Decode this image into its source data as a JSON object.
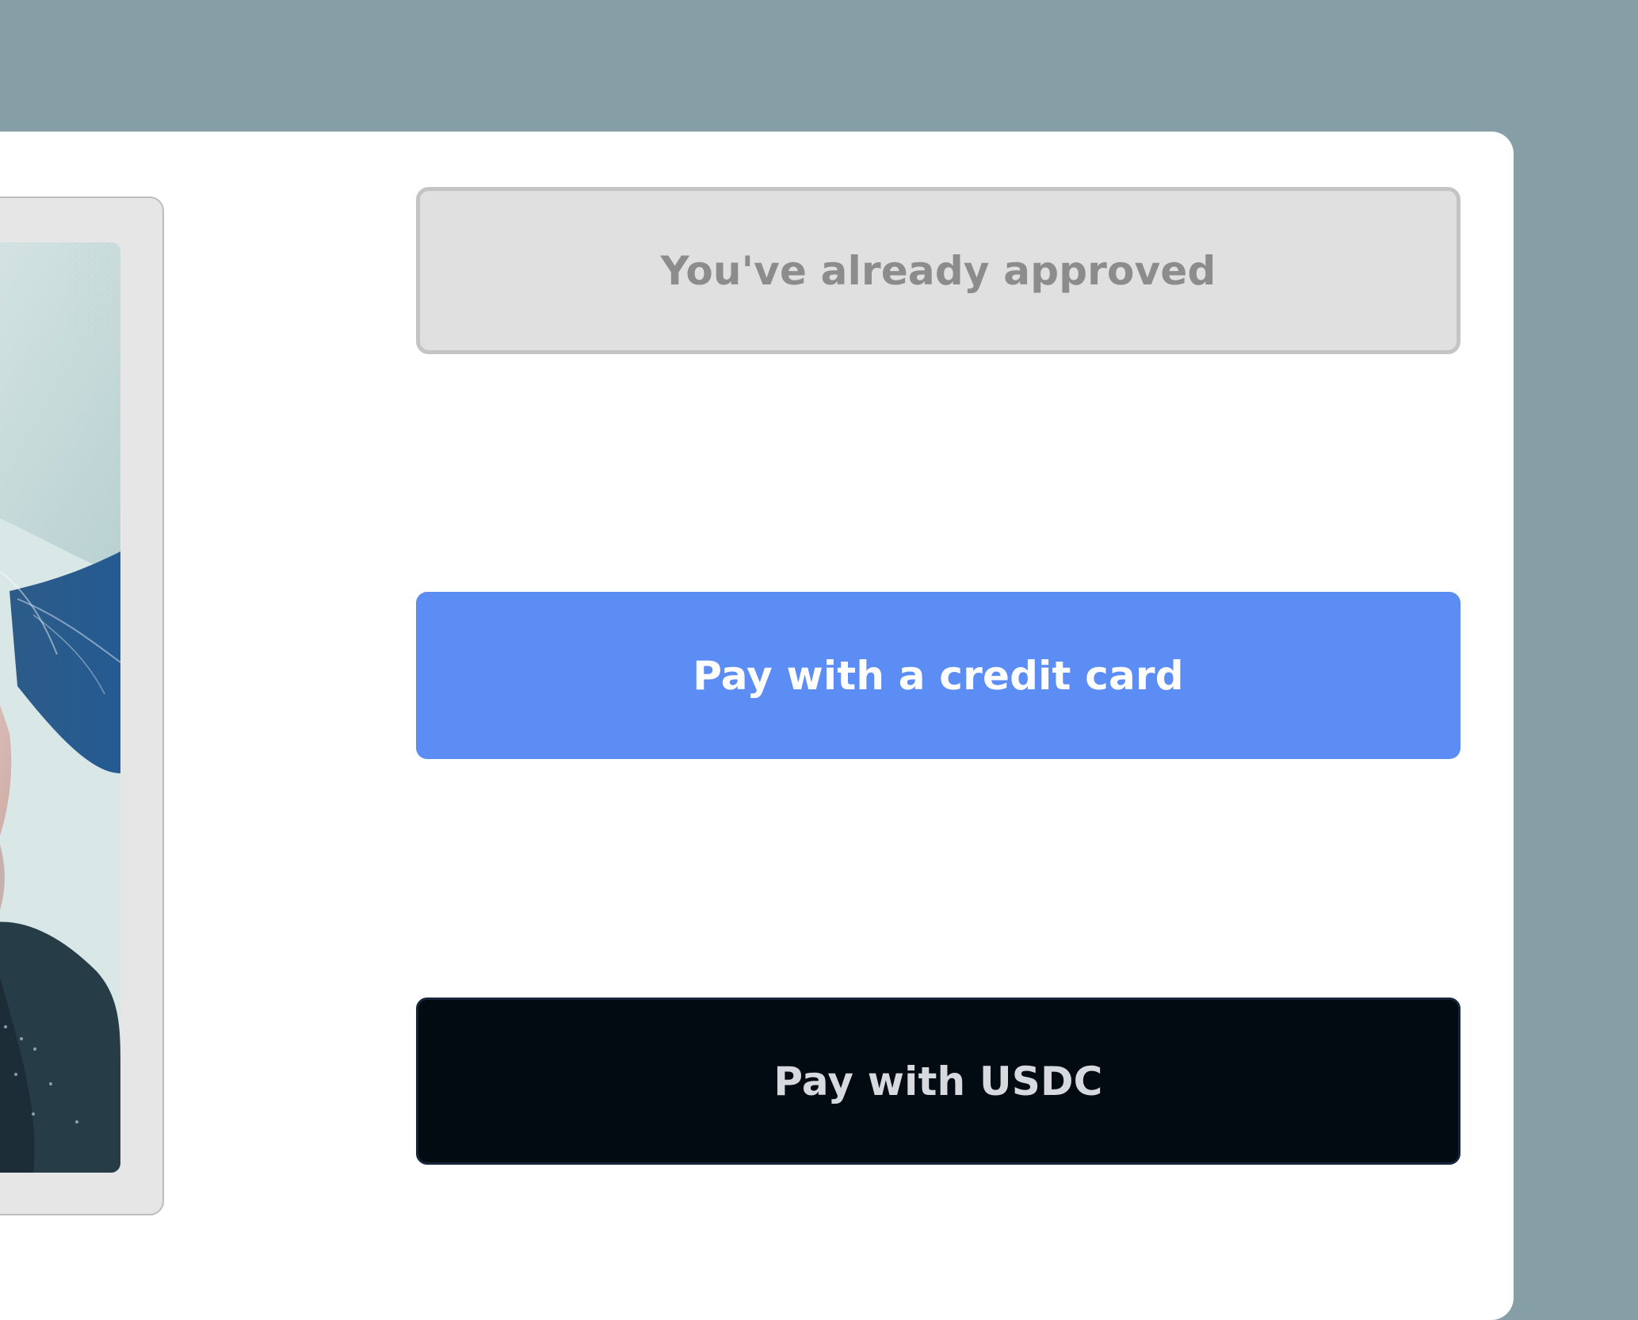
{
  "colors": {
    "background": "#869fa6",
    "panel": "#ffffff",
    "approved_button_bg": "#e0e0e0",
    "approved_button_text": "#8c8c8c",
    "credit_button_bg": "#5b8df5",
    "credit_button_text": "#ffffff",
    "usdc_button_bg": "#030b12",
    "usdc_button_text": "#d6d9dd"
  },
  "actions": {
    "approved_label": "You've already approved",
    "credit_card_label": "Pay with a credit card",
    "usdc_label": "Pay with USDC"
  }
}
